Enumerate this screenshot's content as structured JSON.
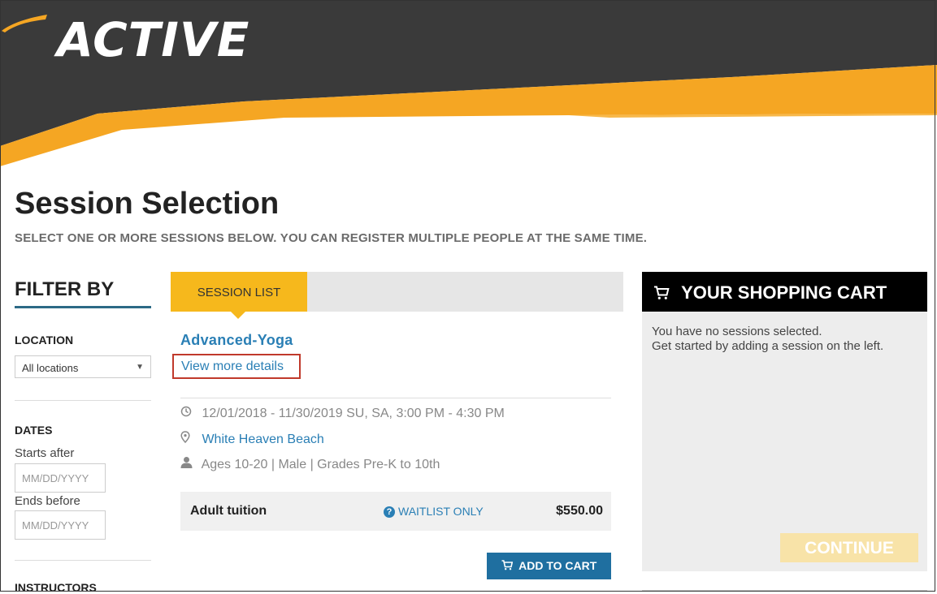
{
  "brand": {
    "logo_text": "ACTIVE",
    "colors": {
      "dark": "#3a3a3a",
      "orange": "#f5a623",
      "blue": "#2a7fb5"
    }
  },
  "page": {
    "title": "Session Selection",
    "subtitle": "SELECT ONE OR MORE SESSIONS BELOW. YOU CAN REGISTER MULTIPLE PEOPLE AT THE SAME TIME."
  },
  "filter": {
    "title": "FILTER BY",
    "location": {
      "label": "LOCATION",
      "selected": "All locations"
    },
    "dates": {
      "label": "DATES",
      "starts_after_label": "Starts after",
      "starts_after_placeholder": "MM/DD/YYYY",
      "ends_before_label": "Ends before",
      "ends_before_placeholder": "MM/DD/YYYY"
    },
    "instructors_label": "INSTRUCTORS"
  },
  "sessions": {
    "tab_label": "SESSION LIST",
    "item": {
      "name": "Advanced-Yoga",
      "details_link": "View more details",
      "schedule": "12/01/2018 - 11/30/2019   SU, SA, 3:00 PM - 4:30 PM",
      "location": "White Heaven Beach",
      "eligibility": "Ages 10-20 | Male | Grades Pre-K to 10th",
      "price_label": "Adult tuition",
      "status": "WAITLIST ONLY",
      "price": "$550.00",
      "add_button": "ADD TO CART"
    }
  },
  "cart": {
    "title": "YOUR SHOPPING CART",
    "empty_line1": "You have no sessions selected.",
    "empty_line2": "Get started by adding a session on the left.",
    "continue_button": "CONTINUE"
  },
  "icons": {
    "clock": "clock-icon",
    "pin": "map-pin-icon",
    "person": "person-icon",
    "question": "question-circle-icon",
    "cart": "cart-icon",
    "caret": "caret-down-icon"
  }
}
